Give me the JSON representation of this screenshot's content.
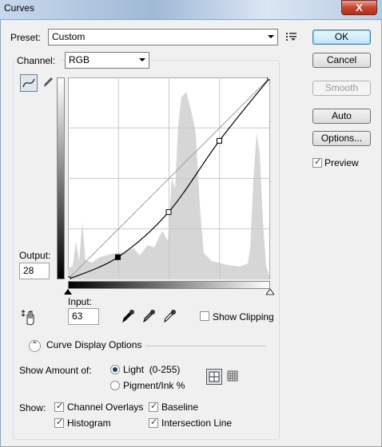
{
  "window": {
    "title": "Curves",
    "close_glyph": "X"
  },
  "preset": {
    "label": "Preset:",
    "value": "Custom"
  },
  "channel": {
    "label": "Channel:",
    "value": "RGB"
  },
  "buttons": {
    "ok": "OK",
    "cancel": "Cancel",
    "smooth": "Smooth",
    "auto": "Auto",
    "options": "Options..."
  },
  "preview": {
    "label": "Preview",
    "checked": true
  },
  "output": {
    "label": "Output:",
    "value": "28"
  },
  "input": {
    "label": "Input:",
    "value": "63"
  },
  "show_clipping": {
    "label": "Show Clipping",
    "checked": false
  },
  "curve_display": {
    "label": "Curve Display Options"
  },
  "show_amount": {
    "label": "Show Amount of:",
    "options": [
      {
        "label": "Light  (0-255)",
        "selected": true
      },
      {
        "label": "Pigment/Ink %",
        "selected": false
      }
    ]
  },
  "show": {
    "label": "Show:",
    "channel_overlays": "Channel Overlays",
    "baseline": "Baseline",
    "histogram": "Histogram",
    "intersection_line": "Intersection Line"
  },
  "icons": [
    "curve-tool-icon",
    "pencil-icon",
    "presets-menu-icon",
    "adjust-hand-icon",
    "black-eyedropper-icon",
    "gray-eyedropper-icon",
    "white-eyedropper-icon",
    "collapse-icon",
    "grid-simple-icon",
    "grid-detailed-icon"
  ],
  "colors": {
    "accent": "#3c7fb1",
    "histogram": "#d6d6d6"
  },
  "curve": {
    "points": [
      [
        0,
        0
      ],
      [
        63,
        28
      ],
      [
        127,
        85
      ],
      [
        191,
        175
      ],
      [
        255,
        255
      ]
    ]
  }
}
